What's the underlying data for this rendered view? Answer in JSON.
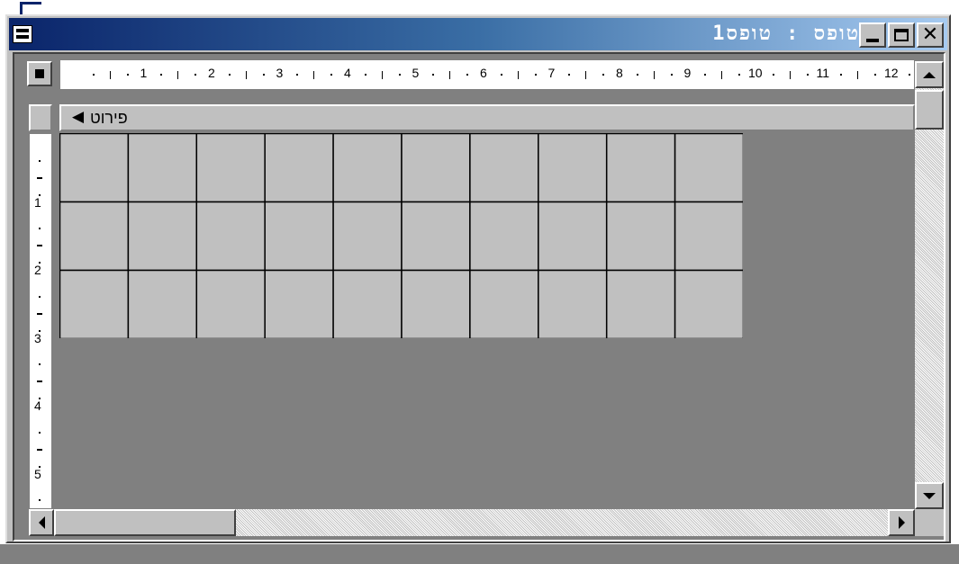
{
  "window": {
    "title": "טופס : טופס1",
    "minimize_icon": "minimize-icon",
    "maximize_icon": "maximize-icon",
    "close_icon": "close-icon",
    "close_glyph": "✕"
  },
  "ruler": {
    "horizontal_labels": [
      "1",
      "2",
      "3",
      "4",
      "5",
      "6",
      "7",
      "8",
      "9",
      "10",
      "11",
      "12"
    ],
    "vertical_labels": [
      "1",
      "2",
      "3",
      "4",
      "5"
    ]
  },
  "section": {
    "label": "פירוט",
    "arrow_icon": "section-arrow-icon"
  },
  "grid": {
    "columns": 10,
    "rows": 3
  },
  "colors": {
    "titlebar_start": "#0a246a",
    "titlebar_end": "#a6caf0",
    "face": "#c0c0c0",
    "workspace": "#808080"
  }
}
